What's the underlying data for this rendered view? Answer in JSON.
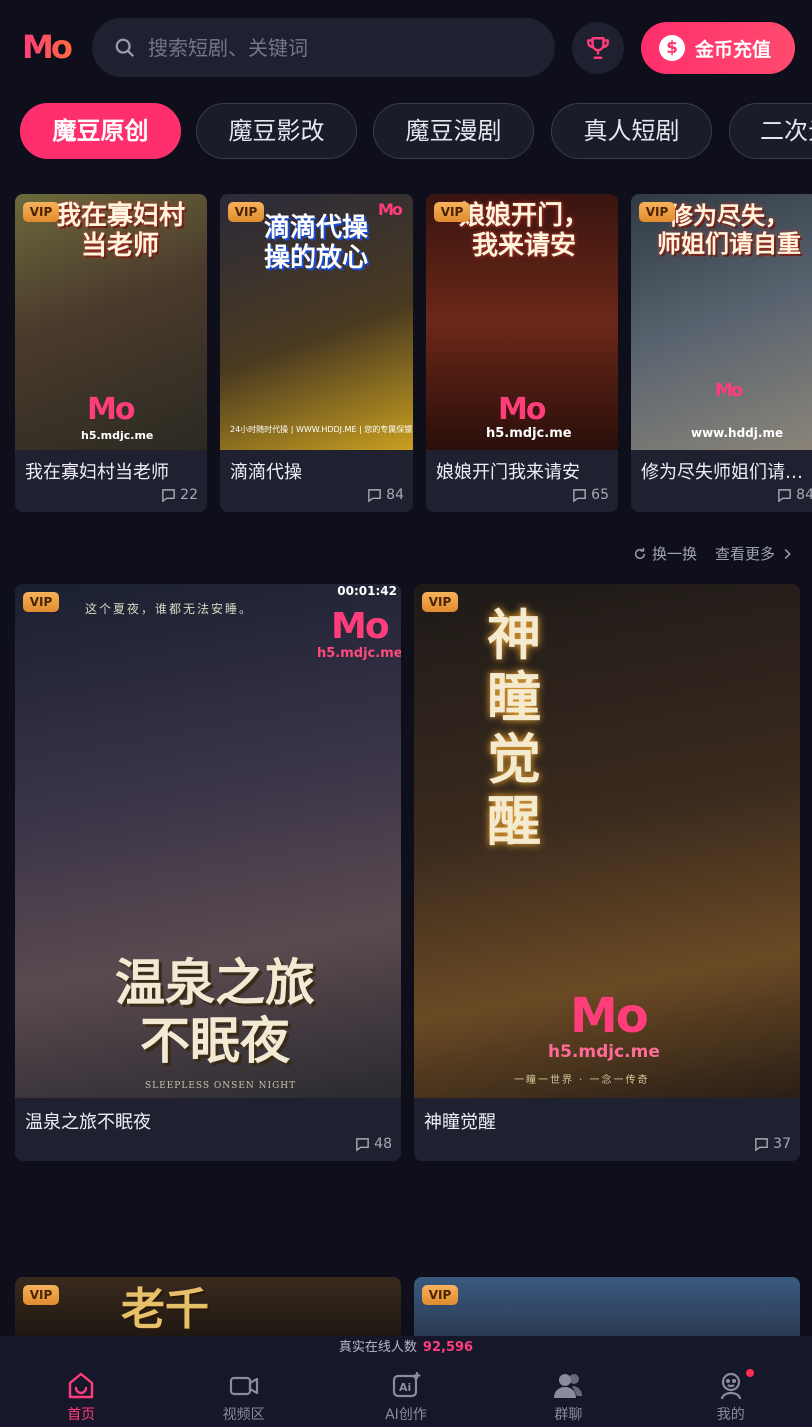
{
  "header": {
    "logo_text": "Mo",
    "search_placeholder": "搜索短剧、关键词",
    "topup_icon": "$",
    "topup_label": "金币充值"
  },
  "tabs": [
    "魔豆原创",
    "魔豆影改",
    "魔豆漫剧",
    "真人短剧",
    "二次元"
  ],
  "active_tab": 0,
  "row1": [
    {
      "vip": "VIP",
      "poster_text": "我在寡妇村\n当老师",
      "watermark": "h5.mdjc.me",
      "title": "我在寡妇村当老师",
      "comments": "22",
      "bg": "linear-gradient(160deg,#6b6a3c 0%,#4a3a2c 45%,#2b2a22 100%)"
    },
    {
      "vip": "VIP",
      "poster_text": "滴滴代操\n操的放心",
      "watermark": "24小时随时代操 | WWW.HDDJ.ME | 您的专属保镖",
      "title": "滴滴代操",
      "comments": "84",
      "bg": "linear-gradient(160deg,#2a2a3a 0%,#4a3a20 50%,#c9a020 100%)"
    },
    {
      "vip": "VIP",
      "poster_text": "娘娘开门，\n我来请安",
      "watermark": "h5.mdjc.me",
      "title": "娘娘开门我来请安",
      "comments": "65",
      "bg": "linear-gradient(180deg,#3a1410 0%,#6a2818 50%,#2a0e0a 100%)"
    },
    {
      "vip": "VIP",
      "poster_text": "修为尽失，\n师姐们请自重",
      "watermark": "www.hddj.me",
      "title": "修为尽失师姐们请自重",
      "comments": "84",
      "bg": "linear-gradient(160deg,#2e3a44 0%,#5a6470 50%,#8a8478 100%)"
    }
  ],
  "actions": {
    "refresh": "换一换",
    "more": "查看更多"
  },
  "row2": [
    {
      "vip": "VIP",
      "duration": "00:01:42",
      "tagline": "这个夏夜，谁都无法安睡。",
      "poster_text": "温泉之旅\n不眠夜",
      "subtitle": "SLEEPLESS ONSEN NIGHT",
      "watermark": "h5.mdjc.me",
      "title": "温泉之旅不眠夜",
      "comments": "48",
      "bg": "linear-gradient(170deg,#1a2030 0%,#3a3448 40%,#5a4a50 70%,#2a2a30 100%)"
    },
    {
      "vip": "VIP",
      "poster_text": "神\n瞳\n觉\n醒",
      "subtitle": "一瞳一世界 · 一念一传奇",
      "watermark": "h5.mdjc.me",
      "title": "神瞳觉醒",
      "comments": "37",
      "bg": "linear-gradient(170deg,#1e1a18 0%,#3a2a1e 45%,#6a4a24 75%,#2a1e16 100%)"
    }
  ],
  "row3": [
    {
      "vip": "VIP",
      "poster_text": "老千",
      "bg": "linear-gradient(180deg,#3a2a1e,#1e1812)"
    },
    {
      "vip": "VIP",
      "poster_text": "",
      "bg": "linear-gradient(180deg,#3a5a80,#2a3a52)"
    }
  ],
  "online": {
    "label": "真实在线人数",
    "count": "92,596"
  },
  "nav": [
    {
      "label": "首页",
      "icon": "home-icon"
    },
    {
      "label": "视频区",
      "icon": "video-icon"
    },
    {
      "label": "AI创作",
      "icon": "ai-create-icon"
    },
    {
      "label": "群聊",
      "icon": "group-chat-icon"
    },
    {
      "label": "我的",
      "icon": "profile-icon"
    }
  ],
  "colors": {
    "accent": "#ff2f6d",
    "background": "#0f0f1b",
    "card": "#1f2030",
    "vip": "#f0a040"
  }
}
